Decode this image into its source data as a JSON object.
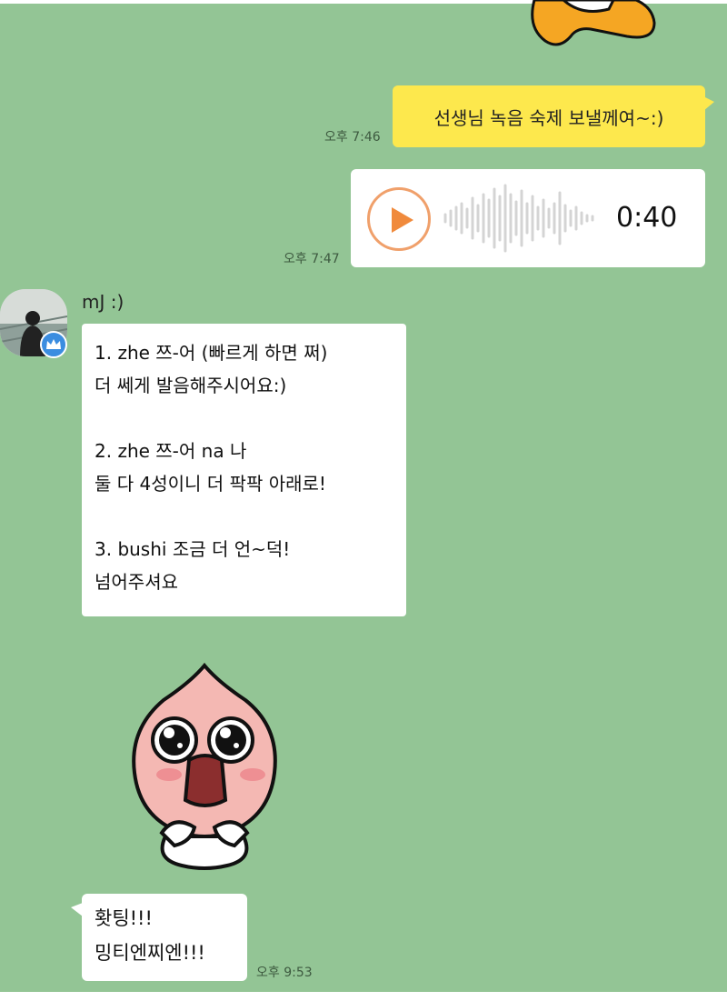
{
  "messages": {
    "out_text": "선생님 녹음 숙제 보낼께여~:)",
    "out_text_time": "오후 7:46",
    "voice_duration": "0:40",
    "voice_time": "오후 7:47",
    "sender_name": "mJ :)",
    "in_lines": [
      "1. zhe 쯔-어 (빠르게 하면 쩌)",
      "더 쎄게 발음해주시어요:)",
      "",
      "2. zhe 쯔-어 na 나",
      "둘 다 4성이니 더 팍팍 아래로!",
      "",
      "3. bushi 조금 더 언~덕!",
      "넘어주셔요"
    ],
    "last_lines": [
      "홧팅!!!",
      "밍티엔찌엔!!!"
    ],
    "last_time": "오후 9:53"
  },
  "icons": {
    "play": "play-icon",
    "crown": "crown-icon",
    "sticker": "peach-crying-sticker"
  },
  "colors": {
    "background": "#93c595",
    "outgoing_bubble": "#fde84d",
    "incoming_bubble": "#ffffff",
    "play_accent": "#f08a3c"
  }
}
